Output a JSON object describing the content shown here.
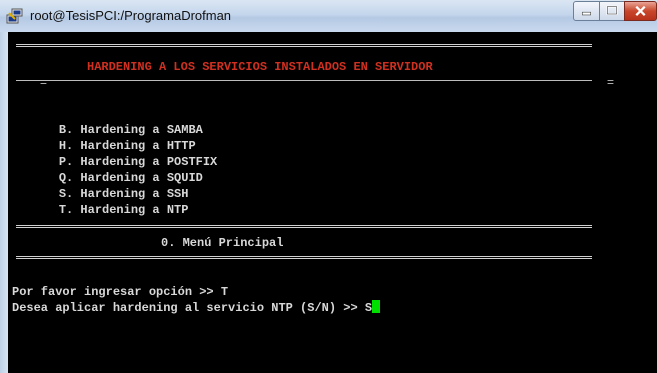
{
  "window": {
    "title": "root@TesisPCI:/ProgramaDrofman",
    "controls": {
      "minimize": "minimize",
      "maximize": "maximize",
      "close": "close"
    }
  },
  "colors": {
    "background": "#000000",
    "header_text": "#d03020",
    "text": "#d8d8d8",
    "cursor": "#00e000"
  },
  "terminal": {
    "header": {
      "left_marker": "=",
      "title": "HARDENING A LOS SERVICIOS INSTALADOS EN SERVIDOR",
      "right_marker": "="
    },
    "menu": [
      {
        "key": "B.",
        "label": "Hardening a SAMBA"
      },
      {
        "key": "H.",
        "label": "Hardening a HTTP"
      },
      {
        "key": "P.",
        "label": "Hardening a POSTFIX"
      },
      {
        "key": "Q.",
        "label": "Hardening a SQUID"
      },
      {
        "key": "S.",
        "label": "Hardening a SSH"
      },
      {
        "key": "T.",
        "label": "Hardening a NTP"
      }
    ],
    "main_menu": "0. Menú Principal",
    "prompt1": "Por favor ingresar opción >> T",
    "prompt2": "Desea aplicar hardening al servicio NTP (S/N) >> S"
  }
}
